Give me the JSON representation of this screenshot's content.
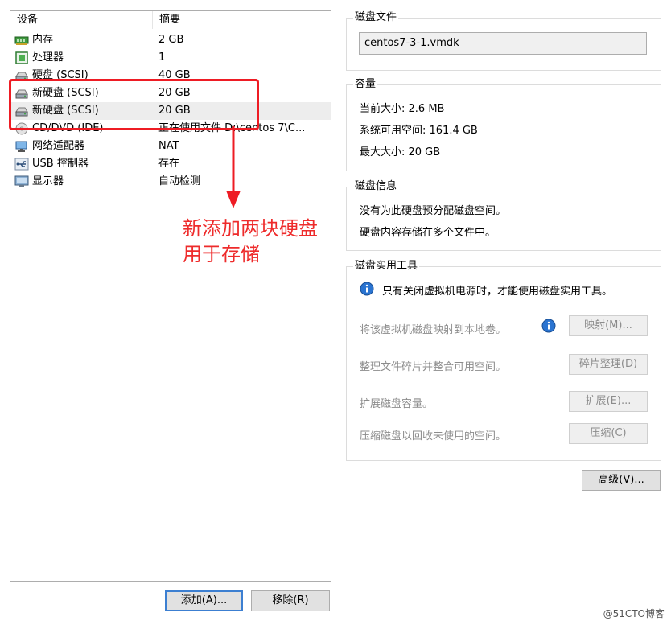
{
  "devices": {
    "columns": {
      "device": "设备",
      "summary": "摘要"
    },
    "rows": [
      {
        "name": "内存",
        "summary": "2 GB",
        "icon": "memory-icon"
      },
      {
        "name": "处理器",
        "summary": "1",
        "icon": "processor-icon"
      },
      {
        "name": "硬盘 (SCSI)",
        "summary": "40 GB",
        "icon": "hard-disk-icon"
      },
      {
        "name": "新硬盘 (SCSI)",
        "summary": "20 GB",
        "icon": "hard-disk-icon"
      },
      {
        "name": "新硬盘 (SCSI)",
        "summary": "20 GB",
        "icon": "hard-disk-icon"
      },
      {
        "name": "CD/DVD (IDE)",
        "summary": "正在使用文件 D:\\centos 7\\C...",
        "icon": "cd-dvd-icon"
      },
      {
        "name": "网络适配器",
        "summary": "NAT",
        "icon": "network-adapter-icon"
      },
      {
        "name": "USB 控制器",
        "summary": "存在",
        "icon": "usb-icon"
      },
      {
        "name": "显示器",
        "summary": "自动检测",
        "icon": "display-icon"
      }
    ],
    "selected_index": 4
  },
  "buttons": {
    "add": "添加(A)...",
    "remove": "移除(R)"
  },
  "disk_file": {
    "label": "磁盘文件",
    "value": "centos7-3-1.vmdk"
  },
  "capacity": {
    "label": "容量",
    "current": "当前大小: 2.6 MB",
    "available": "系统可用空间: 161.4 GB",
    "max": "最大大小: 20 GB"
  },
  "disk_info": {
    "label": "磁盘信息",
    "line1": "没有为此硬盘预分配磁盘空间。",
    "line2": "硬盘内容存储在多个文件中。"
  },
  "utilities": {
    "label": "磁盘实用工具",
    "notice": "只有关闭虚拟机电源时，才能使用磁盘实用工具。",
    "map_text": "将该虚拟机磁盘映射到本地卷。",
    "map_btn": "映射(M)...",
    "defrag_text": "整理文件碎片并整合可用空间。",
    "defrag_btn": "碎片整理(D)",
    "expand_text": "扩展磁盘容量。",
    "expand_btn": "扩展(E)...",
    "compact_text": "压缩磁盘以回收未使用的空间。",
    "compact_btn": "压缩(C)"
  },
  "advanced_btn": "高级(V)...",
  "annotation": {
    "line1": "新添加两块硬盘",
    "line2": "用于存储"
  },
  "watermark": "@51CTO博客",
  "colors": {
    "annotation_red": "#ee1c24",
    "info_blue": "#1e6fd0"
  }
}
